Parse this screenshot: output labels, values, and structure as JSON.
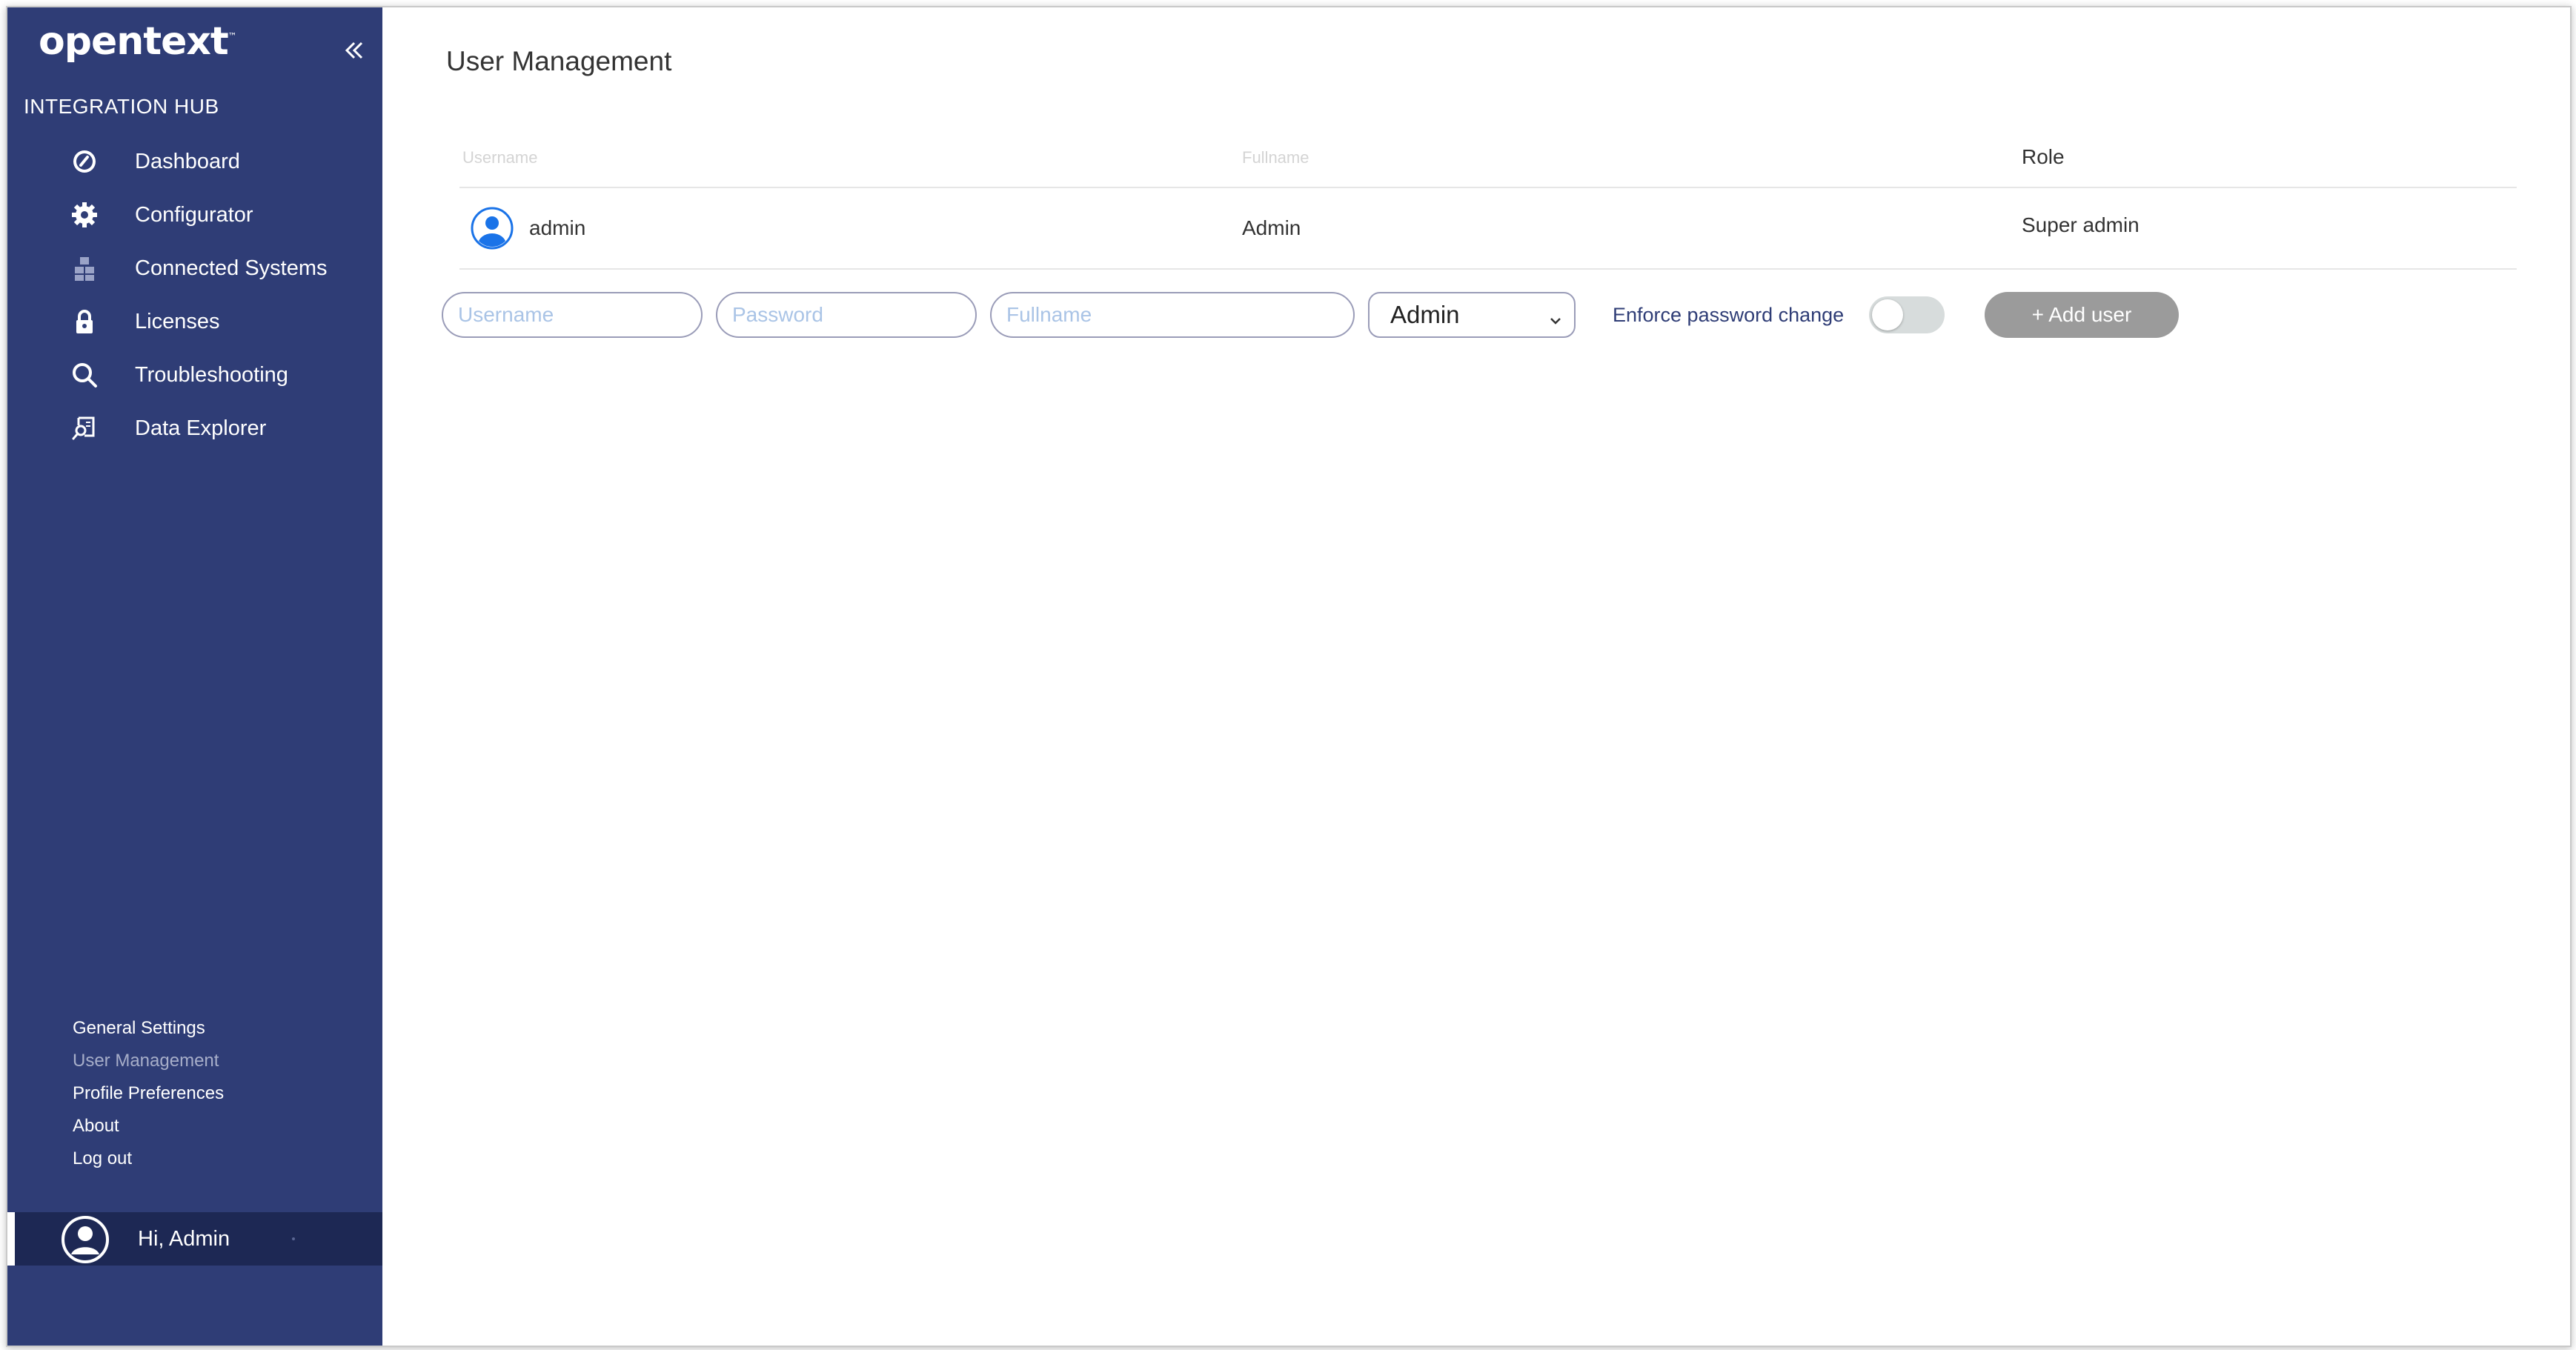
{
  "app": {
    "logo": "opentext",
    "logo_tm": "™",
    "hub_title": "INTEGRATION HUB"
  },
  "sidebar": {
    "items": [
      {
        "label": "Dashboard",
        "icon": "dashboard-icon"
      },
      {
        "label": "Configurator",
        "icon": "gear-icon"
      },
      {
        "label": "Connected Systems",
        "icon": "connected-systems-icon"
      },
      {
        "label": "Licenses",
        "icon": "lock-icon"
      },
      {
        "label": "Troubleshooting",
        "icon": "search-icon"
      },
      {
        "label": "Data Explorer",
        "icon": "data-explorer-icon"
      }
    ],
    "bottom_links": [
      {
        "label": "General Settings",
        "active": false
      },
      {
        "label": "User Management",
        "active": true
      },
      {
        "label": "Profile Preferences",
        "active": false
      },
      {
        "label": "About",
        "active": false
      },
      {
        "label": "Log out",
        "active": false
      }
    ],
    "greeting": "Hi, Admin"
  },
  "main": {
    "title": "User Management",
    "table": {
      "headers": {
        "username": "Username",
        "fullname": "Fullname",
        "role": "Role"
      },
      "rows": [
        {
          "username": "admin",
          "fullname": "Admin",
          "role": "Super admin"
        }
      ]
    },
    "form": {
      "username_placeholder": "Username",
      "password_placeholder": "Password",
      "fullname_placeholder": "Fullname",
      "role_value": "Admin",
      "enforce_label": "Enforce password change",
      "enforce_on": false,
      "add_button": "+ Add user"
    }
  },
  "colors": {
    "sidebar": "#2f3d76",
    "sidebar_dark": "#1d2854",
    "accent_blue": "#1a73e8",
    "button_gray": "#9b9b9b"
  }
}
